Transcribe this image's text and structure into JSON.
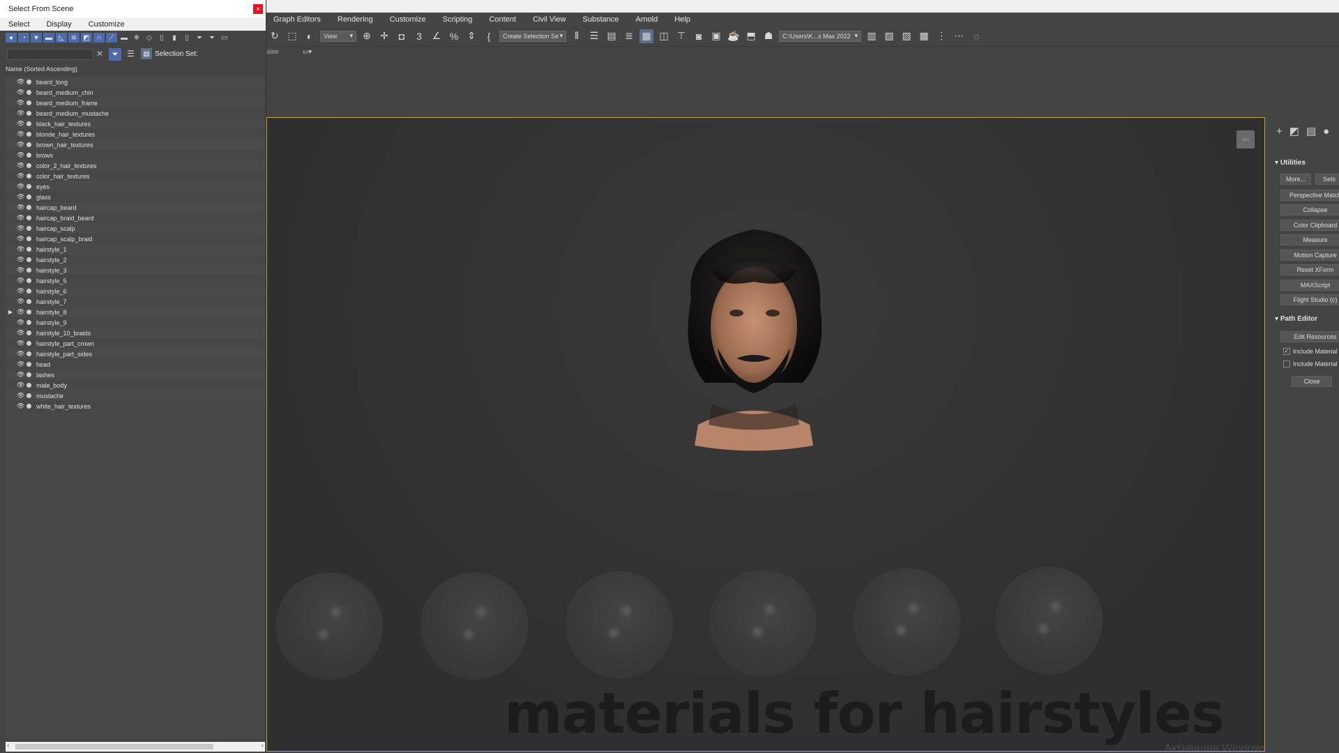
{
  "menubar": [
    "Graph Editors",
    "Rendering",
    "Customize",
    "Scripting",
    "Content",
    "Civil View",
    "Substance",
    "Arnold",
    "Help"
  ],
  "toolbar": {
    "view_dropdown": "View",
    "selection_set_dropdown": "Create Selection Se",
    "path_dropdown": "C:\\Users\\K...s Max 2022"
  },
  "subbar": {
    "label": "ulate"
  },
  "dialog": {
    "title": "Select From Scene",
    "close_glyph": "×",
    "menu": [
      "Select",
      "Display",
      "Customize"
    ],
    "search_value": "",
    "selection_set_label": "Selection Set:",
    "column_header": "Name (Sorted Ascending)",
    "items": [
      "beard_long",
      "beard_medium_chin",
      "beard_medium_frame",
      "beard_medium_mustache",
      "black_hair_textures",
      "blonde_hair_textures",
      "brown_hair_textures",
      "brows",
      "color_2_hair_textures",
      "color_hair_textures",
      "eyes",
      "glass",
      "haircap_beard",
      "haircap_braid_beard",
      "haircap_scalp",
      "haircap_scalp_braid",
      "hairstyle_1",
      "hairstyle_2",
      "hairstyle_3",
      "hairstyle_5",
      "hairstyle_6",
      "hairstyle_7",
      "hairstyle_8",
      "hairstyle_9",
      "hairstyle_10_braids",
      "hairstyle_part_crown",
      "hairstyle_part_sides",
      "head",
      "lashes",
      "male_body",
      "mustache",
      "white_hair_textures"
    ],
    "expanded_item_index": 22
  },
  "viewport": {
    "caption": "materials for hairstyles",
    "watermark": "Активация Windows",
    "nav_label": "nav"
  },
  "command_panel": {
    "utilities_title": "Utilities",
    "more_button": "More...",
    "sets_button": "Sets",
    "utility_buttons": [
      "Perspective Match",
      "Collapse",
      "Color Clipboard",
      "Measure",
      "Motion Capture",
      "Reset XForm",
      "MAXScript",
      "Flight Studio (c)"
    ],
    "path_editor_title": "Path Editor",
    "edit_resources_button": "Edit Resources",
    "include_material_1": "Include Material E",
    "include_material_1_checked": true,
    "include_material_2": "Include Material L",
    "include_material_2_checked": false,
    "close_button": "Close"
  },
  "colors": {
    "accent": "#4d6ba8",
    "viewport_border": "#c9a23a",
    "close_red": "#e81123"
  }
}
